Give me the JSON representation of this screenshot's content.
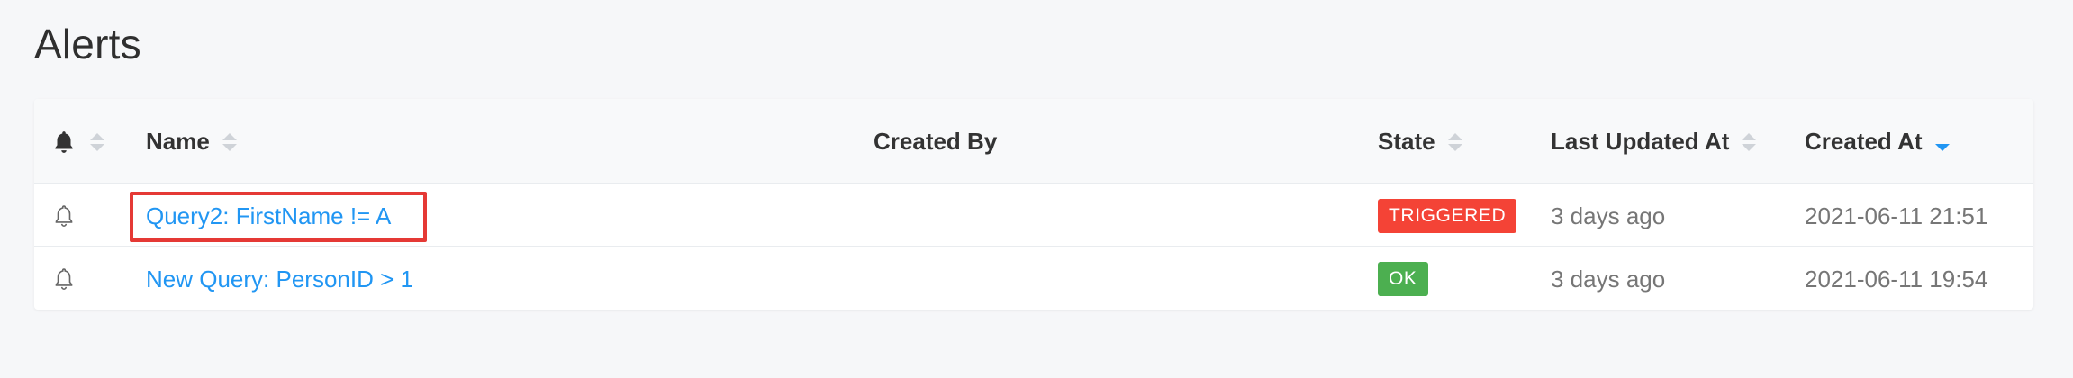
{
  "page": {
    "title": "Alerts"
  },
  "table": {
    "columns": {
      "name": "Name",
      "created_by": "Created By",
      "state": "State",
      "last_updated": "Last Updated At",
      "created_at": "Created At"
    },
    "sort": {
      "column": "created_at",
      "direction": "desc"
    },
    "rows": [
      {
        "name": "Query2: FirstName != A",
        "created_by": "",
        "state": "TRIGGERED",
        "state_color": "#f44336",
        "last_updated": "3 days ago",
        "created_at": "2021-06-11 21:51",
        "highlighted": true
      },
      {
        "name": "New Query: PersonID > 1",
        "created_by": "",
        "state": "OK",
        "state_color": "#4caf50",
        "last_updated": "3 days ago",
        "created_at": "2021-06-11 19:54",
        "highlighted": false
      }
    ]
  },
  "colors": {
    "link": "#2196f3",
    "highlight_box": "#e53935",
    "sort_active": "#2196f3"
  },
  "icons": {
    "header": "bell-solid-icon",
    "row": "bell-outline-icon"
  }
}
